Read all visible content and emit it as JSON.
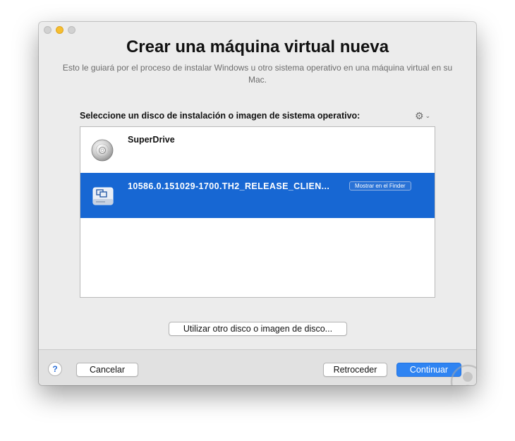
{
  "window": {
    "title": "Crear una máquina virtual nueva",
    "subtitle": "Esto le guiará por el proceso de instalar Windows u otro sistema operativo en una máquina virtual en su Mac."
  },
  "list": {
    "label": "Seleccione un disco de instalación o imagen de sistema operativo:",
    "gear_icon": "gear-icon",
    "items": [
      {
        "name": "SuperDrive",
        "icon": "disc-icon",
        "selected": false
      },
      {
        "name": "10586.0.151029-1700.TH2_RELEASE_CLIEN...",
        "icon": "disk-image-icon",
        "selected": true,
        "action": "Mostrar en el Finder"
      }
    ]
  },
  "buttons": {
    "other_disk": "Utilizar otro disco o imagen de disco...",
    "help": "?",
    "cancel": "Cancelar",
    "back": "Retroceder",
    "continue": "Continuar"
  },
  "colors": {
    "selection": "#1767d3",
    "primary_button": "#2f84f2",
    "minimize_light": "#f6be30"
  }
}
